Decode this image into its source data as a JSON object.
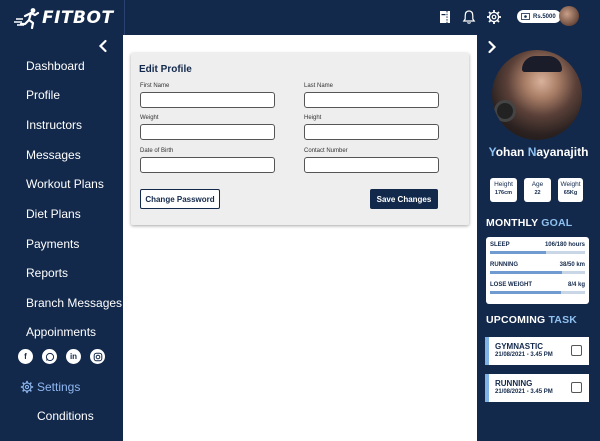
{
  "brand": {
    "name": "FITBOT"
  },
  "topbar": {
    "balance": "Rs.5000",
    "icons": [
      "coupon-icon",
      "bell-icon",
      "gear-icon"
    ]
  },
  "sidebar": {
    "items": [
      {
        "label": "Dashboard"
      },
      {
        "label": "Profile"
      },
      {
        "label": "Instructors"
      },
      {
        "label": "Messages"
      },
      {
        "label": "Workout Plans"
      },
      {
        "label": "Diet Plans"
      },
      {
        "label": "Payments"
      },
      {
        "label": "Reports"
      },
      {
        "label": "Branch Messages"
      },
      {
        "label": "Appoinments"
      }
    ],
    "socials": [
      "facebook-icon",
      "whatsapp-icon",
      "linkedin-icon",
      "instagram-icon"
    ],
    "settings_label": "Settings",
    "conditions_label": "Conditions"
  },
  "form": {
    "title": "Edit Profile",
    "fields": {
      "first_name": {
        "label": "First Name",
        "value": ""
      },
      "last_name": {
        "label": "Last Name",
        "value": ""
      },
      "weight": {
        "label": "Weight",
        "value": ""
      },
      "height": {
        "label": "Height",
        "value": ""
      },
      "dob": {
        "label": "Date of Birth",
        "value": ""
      },
      "contact": {
        "label": "Contact Number",
        "value": ""
      }
    },
    "change_password_label": "Change Password",
    "save_label": "Save Changes"
  },
  "profile": {
    "first_initial": "Y",
    "first_rest": "ohan ",
    "last_initial": "N",
    "last_rest": "ayanajith",
    "stats": [
      {
        "label": "Height",
        "value": "176cm"
      },
      {
        "label": "Age",
        "value": "22"
      },
      {
        "label": "Weight",
        "value": "65Kg"
      }
    ]
  },
  "goals": {
    "title_main": "MONTHLY ",
    "title_accent": "GOAL",
    "items": [
      {
        "name": "SLEEP",
        "progress_text": "106/180 hours",
        "fraction": 0.59
      },
      {
        "name": "RUNNING",
        "progress_text": "38/50 km",
        "fraction": 0.76
      },
      {
        "name": "LOSE WEIGHT",
        "progress_text": "8/4 kg",
        "fraction": 0.75
      }
    ]
  },
  "tasks": {
    "title_main": "UPCOMING ",
    "title_accent": "TASK",
    "items": [
      {
        "name": "GYMNASTIC",
        "time": "21/08/2021 - 3.45 PM",
        "checked": false
      },
      {
        "name": "RUNNING",
        "time": "21/08/2021 - 3.45 PM",
        "checked": false
      }
    ]
  },
  "colors": {
    "navy": "#13294b",
    "accent_light_blue": "#8fc0f0",
    "progress_fill": "#6f9bd0",
    "card_bg": "#eeeeee"
  }
}
